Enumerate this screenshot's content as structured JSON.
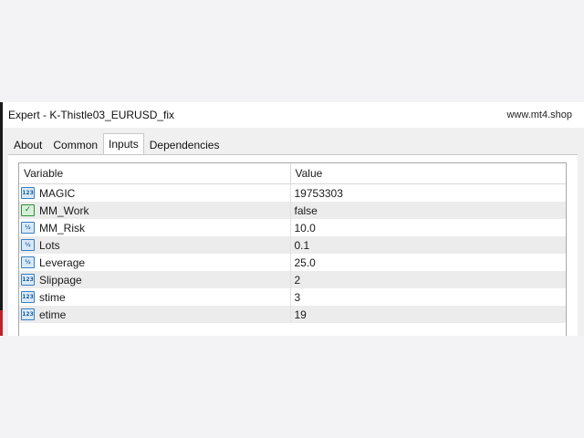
{
  "window": {
    "title": "Expert - K-Thistle03_EURUSD_fix",
    "watermark": "www.mt4.shop"
  },
  "tabs": [
    {
      "label": "About",
      "active": false
    },
    {
      "label": "Common",
      "active": false
    },
    {
      "label": "Inputs",
      "active": true
    },
    {
      "label": "Dependencies",
      "active": false
    }
  ],
  "table": {
    "headers": {
      "variable": "Variable",
      "value": "Value"
    },
    "rows": [
      {
        "name": "MAGIC",
        "value": "19753303",
        "icon": "integer-icon",
        "glyph": "123"
      },
      {
        "name": "MM_Work",
        "value": "false",
        "icon": "boolean-icon",
        "glyph": "✓"
      },
      {
        "name": "MM_Risk",
        "value": "10.0",
        "icon": "double-icon",
        "glyph": "½"
      },
      {
        "name": "Lots",
        "value": "0.1",
        "icon": "double-icon",
        "glyph": "½"
      },
      {
        "name": "Leverage",
        "value": "25.0",
        "icon": "double-icon",
        "glyph": "½"
      },
      {
        "name": "Slippage",
        "value": "2",
        "icon": "integer-icon",
        "glyph": "123"
      },
      {
        "name": "stime",
        "value": "3",
        "icon": "integer-icon",
        "glyph": "123"
      },
      {
        "name": "etime",
        "value": "19",
        "icon": "integer-icon",
        "glyph": "123"
      }
    ]
  },
  "colors": {
    "accent_left": "#c0202a",
    "row_alt": "#ececec"
  }
}
